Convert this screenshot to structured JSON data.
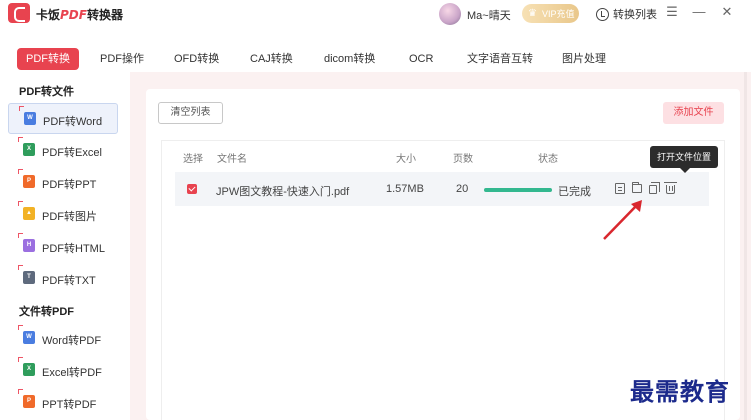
{
  "app": {
    "title_prefix": "卡饭",
    "title_em": "PDF",
    "title_suffix": "转换器",
    "username": "Ma~晴天",
    "vip_label": "VIP充值",
    "convert_list_label": "转换列表",
    "win_buttons": [
      "☰",
      "—",
      "✕"
    ]
  },
  "tabs": [
    {
      "label": "PDF转换",
      "active": true
    },
    {
      "label": "PDF操作"
    },
    {
      "label": "OFD转换"
    },
    {
      "label": "CAJ转换"
    },
    {
      "label": "dicom转换"
    },
    {
      "label": "OCR"
    },
    {
      "label": "文字语音互转"
    },
    {
      "label": "图片处理"
    }
  ],
  "sidebar": {
    "section1_title": "PDF转文件",
    "section1_items": [
      {
        "label": "PDF转Word",
        "badge": "W",
        "color": "#4a7de0",
        "active": true
      },
      {
        "label": "PDF转Excel",
        "badge": "X",
        "color": "#2f9d5c"
      },
      {
        "label": "PDF转PPT",
        "badge": "P",
        "color": "#f06a2a"
      },
      {
        "label": "PDF转图片",
        "badge": "▲",
        "color": "#f2b225"
      },
      {
        "label": "PDF转HTML",
        "badge": "H",
        "color": "#9b6fe0"
      },
      {
        "label": "PDF转TXT",
        "badge": "T",
        "color": "#5e6a7d"
      }
    ],
    "section2_title": "文件转PDF",
    "section2_items": [
      {
        "label": "Word转PDF",
        "badge": "W",
        "color": "#4a7de0"
      },
      {
        "label": "Excel转PDF",
        "badge": "X",
        "color": "#2f9d5c"
      },
      {
        "label": "PPT转PDF",
        "badge": "P",
        "color": "#f06a2a"
      }
    ]
  },
  "main": {
    "clear_button": "清空列表",
    "add_button": "添加文件",
    "columns": {
      "select": "选择",
      "filename": "文件名",
      "size": "大小",
      "pages": "页数",
      "status": "状态"
    },
    "rows": [
      {
        "checked": true,
        "filename": "JPW图文教程-快速入门.pdf",
        "size": "1.57MB",
        "pages": "20",
        "progress": 1.0,
        "status": "已完成"
      }
    ],
    "tooltip": "打开文件位置"
  },
  "watermark": "最需教育",
  "colors": {
    "accent": "#e8434f",
    "progress": "#33b88f",
    "arrow": "#d9272e",
    "watermark": "#1c2a8c"
  }
}
